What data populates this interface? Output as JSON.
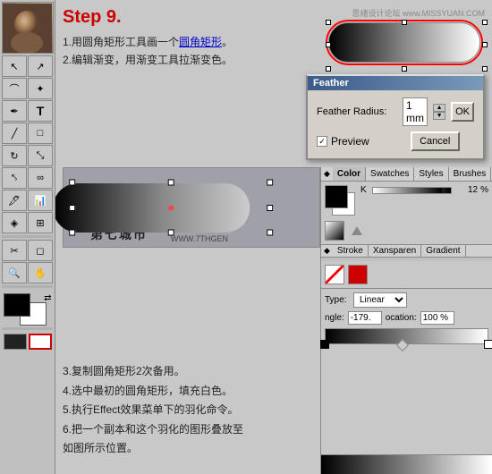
{
  "toolbar": {
    "top_image_alt": "Portrait image"
  },
  "header": {
    "step_title": "Step 9.",
    "instruction1": "1.用圆角矩形工具画一个",
    "instruction1_highlight": "圆角矩形",
    "instruction1_end": "。",
    "instruction2": "2.编辑渐变，用渐变工具拉渐变色。"
  },
  "watermark": {
    "site": "思绪设计论坛 www.MISSYUAN.COM",
    "zh_text": "第七城市",
    "en_text": "WWW.7THGEN"
  },
  "feather_dialog": {
    "title": "Feather",
    "radius_label": "Feather Radius:",
    "radius_value": "1 mm",
    "ok_label": "OK",
    "preview_label": "Preview",
    "cancel_label": "Cancel"
  },
  "color_panel": {
    "tab_arrow": "◆",
    "tab_color": "Color",
    "tab_swatches": "Swatches",
    "tab_styles": "Styles",
    "tab_brushes": "Brushes",
    "k_label": "K",
    "k_value": "12",
    "percent": "%"
  },
  "stroke_panel": {
    "tab_stroke": "Stroke",
    "tab_transparency": "Xansparen",
    "tab_gradient": "Gradient",
    "tab_arrow": "◆"
  },
  "gradient_panel": {
    "type_label": "Type:",
    "type_value": "Linear",
    "angle_label": "ngle:",
    "angle_value": "-179.",
    "location_label": "ocation:",
    "location_value": "100 %"
  },
  "bottom_instructions": {
    "line3": "3.复制圆角矩形2次备用。",
    "line4": "4.选中最初的圆角矩形，填充白色。",
    "line5": "5.执行Effect效果菜单下的羽化命令。",
    "line6": "6.把一个副本和这个羽化的图形叠放至",
    "line6b": "如图所示位置。"
  }
}
